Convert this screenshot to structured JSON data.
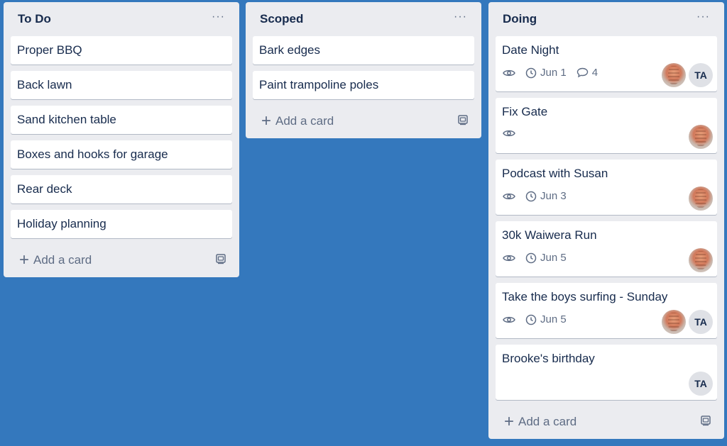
{
  "lists": [
    {
      "title": "To Do",
      "menu": "···",
      "cards": [
        "Proper BBQ",
        "Back lawn",
        "Sand kitchen table",
        "Boxes and hooks for garage",
        "Rear deck",
        "Holiday planning"
      ],
      "add_label": "Add a card"
    },
    {
      "title": "Scoped",
      "menu": "···",
      "cards": [
        "Bark edges",
        "Paint trampoline poles"
      ],
      "add_label": "Add a card"
    },
    {
      "title": "Doing",
      "menu": "···",
      "cards": [
        {
          "title": "Date Night",
          "watch": true,
          "due": "Jun 1",
          "comments": "4",
          "members": [
            "photo",
            "TA"
          ]
        },
        {
          "title": "Fix Gate",
          "watch": true,
          "members": [
            "photo"
          ]
        },
        {
          "title": "Podcast with Susan",
          "watch": true,
          "due": "Jun 3",
          "members": [
            "photo"
          ]
        },
        {
          "title": "30k Waiwera Run",
          "watch": true,
          "due": "Jun 5",
          "members": [
            "photo"
          ]
        },
        {
          "title": "Take the boys surfing - Sunday",
          "watch": true,
          "due": "Jun 5",
          "members": [
            "photo",
            "TA"
          ]
        },
        {
          "title": "Brooke's birthday",
          "members": [
            "TA"
          ]
        }
      ],
      "add_label": "Add a card"
    }
  ],
  "icons": {
    "watch": "eye-icon",
    "due": "clock-icon",
    "comments": "comment-icon",
    "add": "plus-icon",
    "template": "card-template-icon",
    "menu": "more-horizontal-icon"
  },
  "colors": {
    "board_background": "#3478bd",
    "list_background": "#ebecf0",
    "card_background": "#ffffff",
    "text": "#172b4d",
    "muted_text": "#5e6c84"
  }
}
